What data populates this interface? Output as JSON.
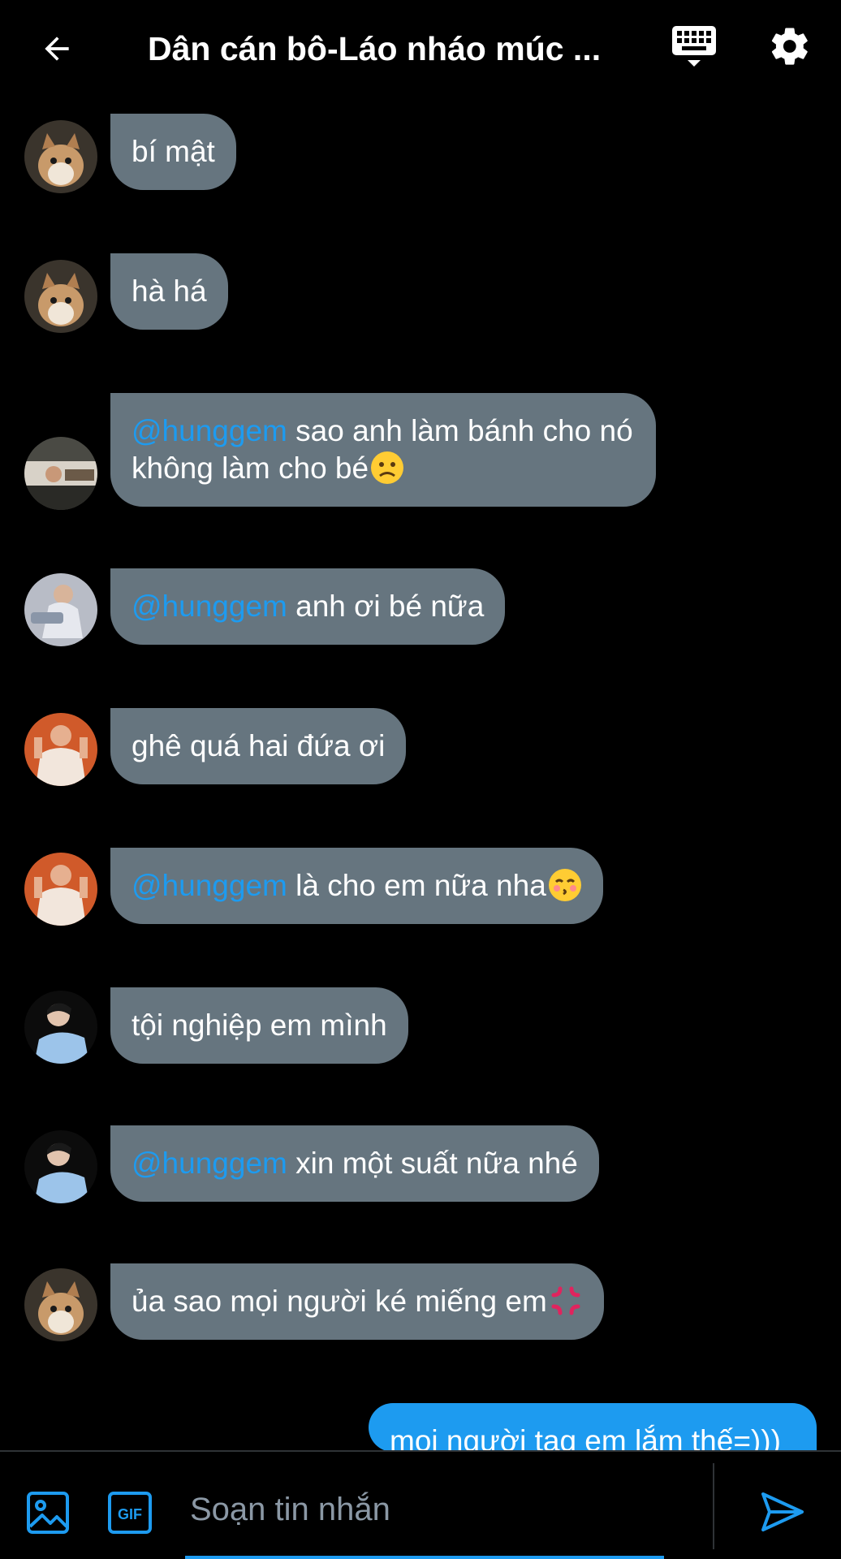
{
  "header": {
    "title": "Dân cán bô-Láo nháo múc ...",
    "back_icon": "arrow-left-icon",
    "keyboard_icon": "keyboard-icon",
    "settings_icon": "gear-icon"
  },
  "messages": [
    {
      "avatar": "cat-avatar",
      "mention": "",
      "text": "bí mật",
      "emoji": ""
    },
    {
      "avatar": "cat-avatar",
      "mention": "",
      "text": "hà há",
      "emoji": ""
    },
    {
      "avatar": "person-avatar",
      "mention": "@hunggem",
      "text": " sao anh làm bánh cho nó không làm cho bé",
      "emoji": "slightly-frowning-face"
    },
    {
      "avatar": "person-avatar",
      "mention": "@hunggem",
      "text": " anh ơi bé nữa",
      "emoji": ""
    },
    {
      "avatar": "person-avatar",
      "mention": "",
      "text": "ghê quá hai đứa ơi",
      "emoji": ""
    },
    {
      "avatar": "person-avatar",
      "mention": "@hunggem",
      "text": " là cho em nữa nha",
      "emoji": "kissing-face"
    },
    {
      "avatar": "person-avatar",
      "mention": "",
      "text": "tội nghiệp em mình",
      "emoji": ""
    },
    {
      "avatar": "person-avatar",
      "mention": "@hunggem",
      "text": " xin một suất nữa nhé",
      "emoji": ""
    },
    {
      "avatar": "cat-avatar",
      "mention": "",
      "text": "ủa sao mọi người ké miếng em",
      "emoji": "anger-symbol"
    }
  ],
  "own_message": {
    "text": "mọi người tag em lắm thế=)))"
  },
  "composer": {
    "placeholder": "Soạn tin nhắn",
    "gif_label": "GIF",
    "image_icon": "image-icon",
    "send_icon": "send-icon"
  },
  "colors": {
    "background": "#000000",
    "incoming_bubble": "#66757f",
    "outgoing_bubble": "#1d9bf0",
    "accent": "#1d9bf0"
  }
}
